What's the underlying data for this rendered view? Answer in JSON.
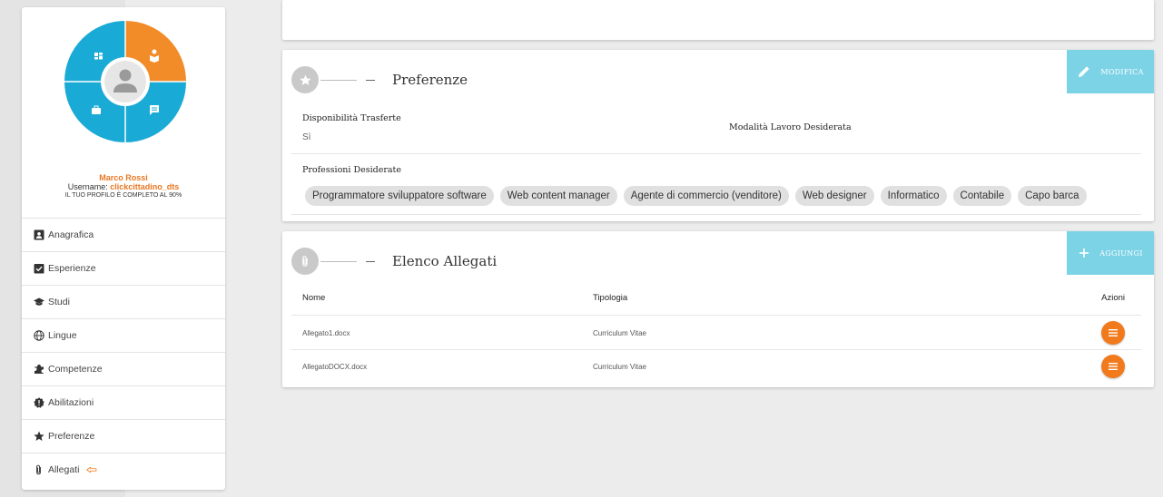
{
  "profile": {
    "name": "Marco Rossi",
    "username_label": "Username:",
    "username": "clickcittadino_dts",
    "completion": "IL TUO PROFILO È COMPLETO AL 90%",
    "wheel_colors": {
      "blue": "#1aaad6",
      "orange": "#f28c28",
      "center": "#e6e6e6"
    }
  },
  "sidebar": {
    "items": [
      {
        "label": "Anagrafica",
        "icon": "id-card-icon"
      },
      {
        "label": "Esperienze",
        "icon": "clipboard-check-icon"
      },
      {
        "label": "Studi",
        "icon": "graduation-cap-icon"
      },
      {
        "label": "Lingue",
        "icon": "globe-icon"
      },
      {
        "label": "Competenze",
        "icon": "puzzle-icon"
      },
      {
        "label": "Abilitazioni",
        "icon": "certificate-icon"
      },
      {
        "label": "Preferenze",
        "icon": "star-icon"
      },
      {
        "label": "Allegati",
        "icon": "paperclip-icon"
      }
    ]
  },
  "preferenze": {
    "title": "Preferenze",
    "edit_label": "MODIFICA",
    "disponibilita_label": "Disponibilità Trasferte",
    "disponibilita_value": "Sì",
    "modalita_label": "Modalità Lavoro Desiderata",
    "professioni_label": "Professioni Desiderate",
    "professioni": [
      "Programmatore sviluppatore software",
      "Web content manager",
      "Agente di commercio (venditore)",
      "Web designer",
      "Informatico",
      "Contabile",
      "Capo barca"
    ]
  },
  "allegati": {
    "title": "Elenco Allegati",
    "add_label": "AGGIUNGI",
    "columns": {
      "nome": "Nome",
      "tipologia": "Tipologia",
      "azioni": "Azioni"
    },
    "rows": [
      {
        "nome": "Allegato1.docx",
        "tipologia": "Curriculum Vitae"
      },
      {
        "nome": "AllegatoDOCX.docx",
        "tipologia": "Curriculum Vitae"
      }
    ]
  },
  "colors": {
    "accent_orange": "#f07a1c",
    "header_button": "#7dd3e6",
    "highlight_orange": "#e87722"
  }
}
